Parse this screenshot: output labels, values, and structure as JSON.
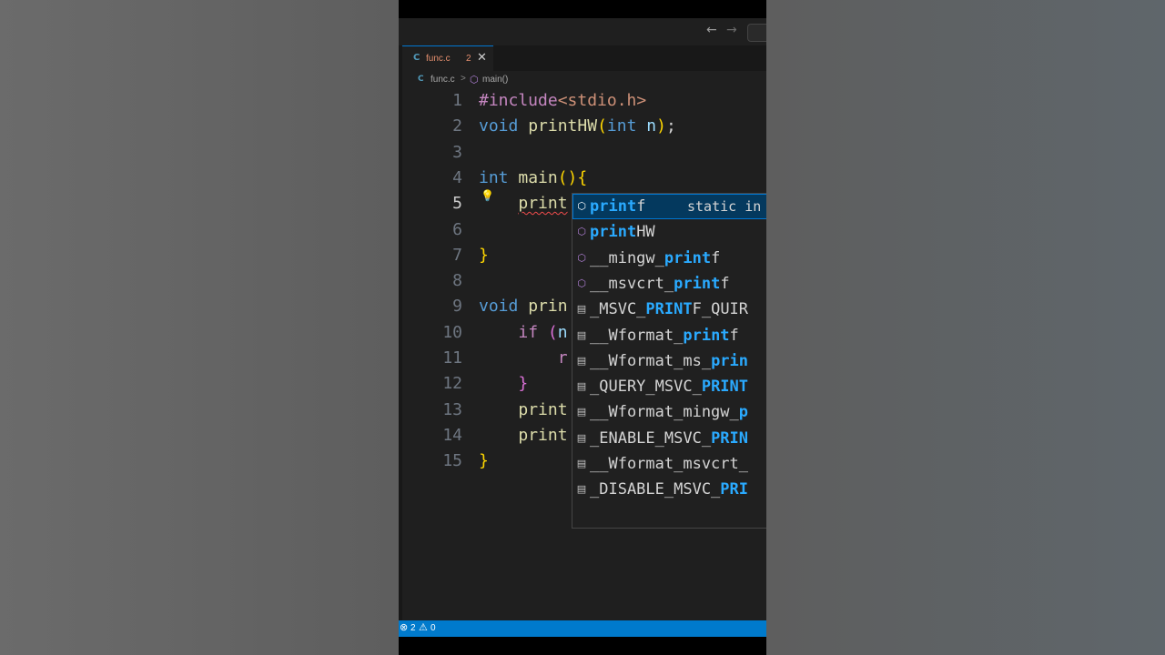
{
  "titlebar": {
    "back_icon": "arrow-left-icon",
    "forward_icon": "arrow-right-icon"
  },
  "tab": {
    "lang_badge": "C",
    "filename": "func.c",
    "problem_count": "2",
    "close_glyph": "✕"
  },
  "breadcrumb": {
    "lang_badge": "C",
    "file": "func.c",
    "separator": ">",
    "symbol_icon": "cube-icon",
    "symbol": "main()"
  },
  "line_numbers": [
    "1",
    "2",
    "3",
    "4",
    "5",
    "6",
    "7",
    "8",
    "9",
    "10",
    "11",
    "12",
    "13",
    "14",
    "15"
  ],
  "current_line": "5",
  "code": {
    "l1": {
      "pp": "#include",
      "str": "<stdio.h>"
    },
    "l2": {
      "kw": "void",
      "fn": "printHW",
      "open": "(",
      "kw2": "int",
      "var": "n",
      "close": ")",
      "semi": ";"
    },
    "l4": {
      "kw": "int",
      "fn": "main",
      "parens": "()",
      "brace": "{"
    },
    "l5": {
      "indent": "    ",
      "typed": "print"
    },
    "l7": {
      "brace": "}"
    },
    "l9": {
      "kw": "void",
      "fn": "prin"
    },
    "l10": {
      "indent": "    ",
      "kw": "if",
      "open": "(",
      "var": "n"
    },
    "l11": {
      "indent": "        ",
      "text": "r"
    },
    "l12": {
      "indent": "    ",
      "brace": "}"
    },
    "l13": {
      "indent": "    ",
      "fn": "print"
    },
    "l14": {
      "indent": "    ",
      "fn": "print"
    },
    "l15": {
      "brace": "}"
    }
  },
  "suggestions": [
    {
      "kind": "method",
      "match": "print",
      "rest": "f",
      "detail": "static in"
    },
    {
      "kind": "method",
      "match": "print",
      "rest": "HW"
    },
    {
      "kind": "method",
      "pre": "__mingw_",
      "match": "print",
      "rest": "f"
    },
    {
      "kind": "method",
      "pre": "__msvcrt_",
      "match": "print",
      "rest": "f"
    },
    {
      "kind": "const",
      "pre": "_MSVC_",
      "match": "PRINT",
      "rest": "F_QUIR"
    },
    {
      "kind": "const",
      "pre": "__Wformat_",
      "match": "print",
      "rest": "f"
    },
    {
      "kind": "const",
      "pre": "__Wformat_ms_",
      "match": "prin",
      "rest": ""
    },
    {
      "kind": "const",
      "pre": "_QUERY_MSVC_",
      "match": "PRINT",
      "rest": ""
    },
    {
      "kind": "const",
      "pre": "__Wformat_mingw_",
      "match": "p",
      "rest": ""
    },
    {
      "kind": "const",
      "pre": "_ENABLE_MSVC_",
      "match": "PRIN",
      "rest": ""
    },
    {
      "kind": "const",
      "pre": "__Wformat_msvcrt_",
      "match": "",
      "rest": ""
    },
    {
      "kind": "const",
      "pre": "_DISABLE_MSVC_",
      "match": "PRI",
      "rest": ""
    }
  ],
  "status": {
    "error_icon": "error-circle-icon",
    "errors": "2",
    "warning_icon": "warning-triangle-icon",
    "warnings": "0"
  },
  "colors": {
    "keyword": "#569cd6",
    "function": "#dcdcaa",
    "preprocessor": "#c586c0",
    "string": "#ce9178",
    "match_highlight": "#2aaaff",
    "statusbar": "#007acc"
  }
}
